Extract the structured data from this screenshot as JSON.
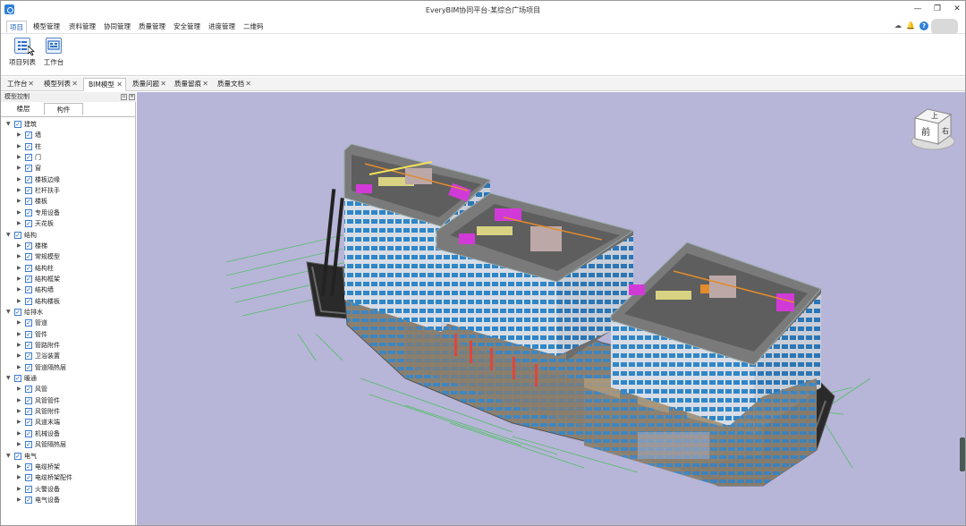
{
  "window": {
    "title": "EveryBIM协同平台-某综合广场项目",
    "controls": [
      "—",
      "❐",
      "✕"
    ]
  },
  "menu": {
    "items": [
      "项目",
      "模型管理",
      "资料管理",
      "协同管理",
      "质量管理",
      "安全管理",
      "进度管理",
      "二维码"
    ]
  },
  "topright_icons": [
    "cloud-icon",
    "bell-icon",
    "help-icon"
  ],
  "ribbon": {
    "buttons": [
      {
        "label": "项目列表",
        "icon": "project-list-icon"
      },
      {
        "label": "工作台",
        "icon": "workbench-icon"
      }
    ]
  },
  "doc_tabs": {
    "items": [
      {
        "label": "工作台",
        "active": false
      },
      {
        "label": "模型列表",
        "active": false
      },
      {
        "label": "BIM模型",
        "active": true
      },
      {
        "label": "质量问题",
        "active": false
      },
      {
        "label": "质量留痕",
        "active": false
      },
      {
        "label": "质量文档",
        "active": false
      }
    ]
  },
  "panel": {
    "title": "模型控制",
    "tabs": [
      {
        "label": "楼层",
        "active": false
      },
      {
        "label": "构件",
        "active": true
      }
    ],
    "tree": [
      {
        "label": "建筑",
        "children": [
          "墙",
          "柱",
          "门",
          "窗",
          "楼板边缘",
          "栏杆扶手",
          "楼板",
          "专用设备",
          "天花板"
        ]
      },
      {
        "label": "结构",
        "children": [
          "楼梯",
          "常规模型",
          "结构柱",
          "结构框架",
          "结构墙",
          "结构楼板"
        ]
      },
      {
        "label": "给排水",
        "children": [
          "管道",
          "管件",
          "管路附件",
          "卫浴装置",
          "管道隔热层"
        ]
      },
      {
        "label": "暖通",
        "children": [
          "风管",
          "风管管件",
          "风管附件",
          "风道末端",
          "机械设备",
          "风管隔热层"
        ]
      },
      {
        "label": "电气",
        "children": [
          "电缆桥架",
          "电缆桥架配件",
          "火警设备",
          "电气设备"
        ]
      }
    ]
  },
  "viewcube": {
    "top": "上",
    "front": "前",
    "right": "右"
  },
  "colors": {
    "viewport_bg": "#b7b5d8",
    "accent": "#2f7fd6",
    "facade_blue": "#2f86c9",
    "roof": "#777777",
    "magenta": "#d23ad8"
  }
}
